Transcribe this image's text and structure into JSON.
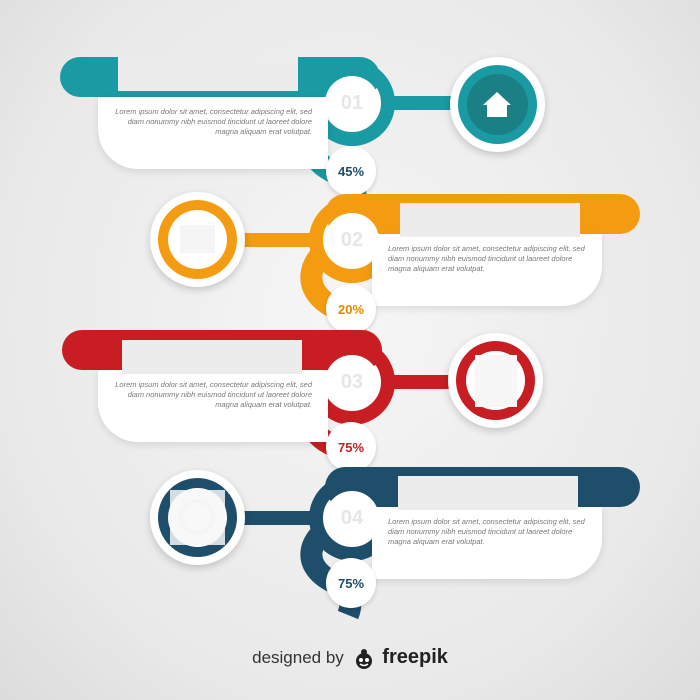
{
  "colors": {
    "teal": "#1a9aa3",
    "orange": "#f39c12",
    "red": "#c81e23",
    "navy": "#1f4e6b"
  },
  "steps": [
    {
      "number": "01",
      "percent": "45%",
      "icon": "home-icon",
      "body": "Lorem ipsum dolor sit amet, consectetur adipiscing elit, sed diam nonummy nibh euismod tincidunt ut laoreet dolore magna aliquam erat volutpat."
    },
    {
      "number": "02",
      "percent": "20%",
      "icon": "image-icon",
      "body": "Lorem ipsum dolor sit amet, consectetur adipiscing elit, sed diam nonummy nibh euismod tincidunt ut laoreet dolore magna aliquam erat volutpat."
    },
    {
      "number": "03",
      "percent": "75%",
      "icon": "lightbulb-icon",
      "body": "Lorem ipsum dolor sit amet, consectetur adipiscing elit, sed diam nonummy nibh euismod tincidunt ut laoreet dolore magna aliquam erat volutpat."
    },
    {
      "number": "04",
      "percent": "75%",
      "icon": "gear-icon",
      "body": "Lorem ipsum dolor sit amet, consectetur adipiscing elit, sed diam nonummy nibh euismod tincidunt ut laoreet dolore magna aliquam erat volutpat."
    }
  ],
  "footer": {
    "prefix": "designed by",
    "brand": "freepik"
  }
}
